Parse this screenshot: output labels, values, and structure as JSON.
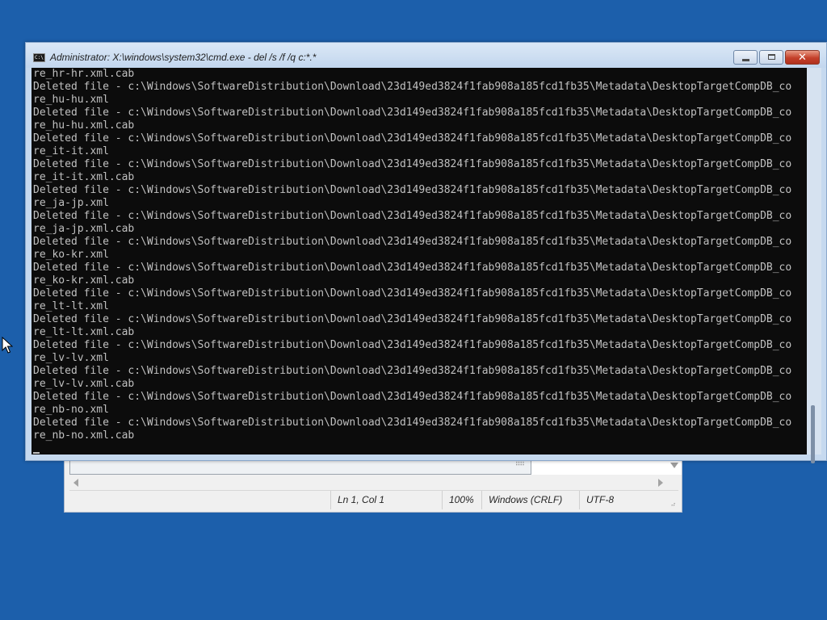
{
  "notepad": {
    "status": {
      "position": "Ln 1, Col 1",
      "zoom": "100%",
      "line_ending": "Windows (CRLF)",
      "encoding": "UTF-8"
    }
  },
  "cmd": {
    "title": "Administrator: X:\\windows\\system32\\cmd.exe - del  /s /f /q c:*.*",
    "icon": "console-app-icon",
    "close_glyph": "✕",
    "lines": [
      "re_hr-hr.xml.cab",
      "Deleted file - c:\\Windows\\SoftwareDistribution\\Download\\23d149ed3824f1fab908a185fcd1fb35\\Metadata\\DesktopTargetCompDB_co",
      "re_hu-hu.xml",
      "Deleted file - c:\\Windows\\SoftwareDistribution\\Download\\23d149ed3824f1fab908a185fcd1fb35\\Metadata\\DesktopTargetCompDB_co",
      "re_hu-hu.xml.cab",
      "Deleted file - c:\\Windows\\SoftwareDistribution\\Download\\23d149ed3824f1fab908a185fcd1fb35\\Metadata\\DesktopTargetCompDB_co",
      "re_it-it.xml",
      "Deleted file - c:\\Windows\\SoftwareDistribution\\Download\\23d149ed3824f1fab908a185fcd1fb35\\Metadata\\DesktopTargetCompDB_co",
      "re_it-it.xml.cab",
      "Deleted file - c:\\Windows\\SoftwareDistribution\\Download\\23d149ed3824f1fab908a185fcd1fb35\\Metadata\\DesktopTargetCompDB_co",
      "re_ja-jp.xml",
      "Deleted file - c:\\Windows\\SoftwareDistribution\\Download\\23d149ed3824f1fab908a185fcd1fb35\\Metadata\\DesktopTargetCompDB_co",
      "re_ja-jp.xml.cab",
      "Deleted file - c:\\Windows\\SoftwareDistribution\\Download\\23d149ed3824f1fab908a185fcd1fb35\\Metadata\\DesktopTargetCompDB_co",
      "re_ko-kr.xml",
      "Deleted file - c:\\Windows\\SoftwareDistribution\\Download\\23d149ed3824f1fab908a185fcd1fb35\\Metadata\\DesktopTargetCompDB_co",
      "re_ko-kr.xml.cab",
      "Deleted file - c:\\Windows\\SoftwareDistribution\\Download\\23d149ed3824f1fab908a185fcd1fb35\\Metadata\\DesktopTargetCompDB_co",
      "re_lt-lt.xml",
      "Deleted file - c:\\Windows\\SoftwareDistribution\\Download\\23d149ed3824f1fab908a185fcd1fb35\\Metadata\\DesktopTargetCompDB_co",
      "re_lt-lt.xml.cab",
      "Deleted file - c:\\Windows\\SoftwareDistribution\\Download\\23d149ed3824f1fab908a185fcd1fb35\\Metadata\\DesktopTargetCompDB_co",
      "re_lv-lv.xml",
      "Deleted file - c:\\Windows\\SoftwareDistribution\\Download\\23d149ed3824f1fab908a185fcd1fb35\\Metadata\\DesktopTargetCompDB_co",
      "re_lv-lv.xml.cab",
      "Deleted file - c:\\Windows\\SoftwareDistribution\\Download\\23d149ed3824f1fab908a185fcd1fb35\\Metadata\\DesktopTargetCompDB_co",
      "re_nb-no.xml",
      "Deleted file - c:\\Windows\\SoftwareDistribution\\Download\\23d149ed3824f1fab908a185fcd1fb35\\Metadata\\DesktopTargetCompDB_co",
      "re_nb-no.xml.cab"
    ]
  },
  "colors": {
    "desktop": "#1c5fab",
    "console_bg": "#0c0c0c",
    "console_text": "#c0c0c0",
    "close_button": "#c4402a"
  },
  "icons": {
    "pointer": "mouse-pointer-icon"
  }
}
